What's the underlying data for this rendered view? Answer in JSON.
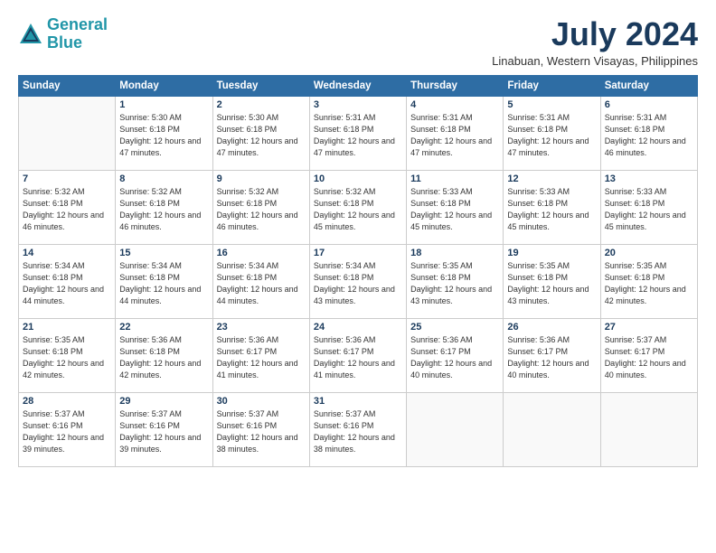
{
  "logo": {
    "line1": "General",
    "line2": "Blue"
  },
  "title": "July 2024",
  "location": "Linabuan, Western Visayas, Philippines",
  "weekdays": [
    "Sunday",
    "Monday",
    "Tuesday",
    "Wednesday",
    "Thursday",
    "Friday",
    "Saturday"
  ],
  "weeks": [
    [
      {
        "day": "",
        "sunrise": "",
        "sunset": "",
        "daylight": ""
      },
      {
        "day": "1",
        "sunrise": "Sunrise: 5:30 AM",
        "sunset": "Sunset: 6:18 PM",
        "daylight": "Daylight: 12 hours and 47 minutes."
      },
      {
        "day": "2",
        "sunrise": "Sunrise: 5:30 AM",
        "sunset": "Sunset: 6:18 PM",
        "daylight": "Daylight: 12 hours and 47 minutes."
      },
      {
        "day": "3",
        "sunrise": "Sunrise: 5:31 AM",
        "sunset": "Sunset: 6:18 PM",
        "daylight": "Daylight: 12 hours and 47 minutes."
      },
      {
        "day": "4",
        "sunrise": "Sunrise: 5:31 AM",
        "sunset": "Sunset: 6:18 PM",
        "daylight": "Daylight: 12 hours and 47 minutes."
      },
      {
        "day": "5",
        "sunrise": "Sunrise: 5:31 AM",
        "sunset": "Sunset: 6:18 PM",
        "daylight": "Daylight: 12 hours and 47 minutes."
      },
      {
        "day": "6",
        "sunrise": "Sunrise: 5:31 AM",
        "sunset": "Sunset: 6:18 PM",
        "daylight": "Daylight: 12 hours and 46 minutes."
      }
    ],
    [
      {
        "day": "7",
        "sunrise": "Sunrise: 5:32 AM",
        "sunset": "Sunset: 6:18 PM",
        "daylight": "Daylight: 12 hours and 46 minutes."
      },
      {
        "day": "8",
        "sunrise": "Sunrise: 5:32 AM",
        "sunset": "Sunset: 6:18 PM",
        "daylight": "Daylight: 12 hours and 46 minutes."
      },
      {
        "day": "9",
        "sunrise": "Sunrise: 5:32 AM",
        "sunset": "Sunset: 6:18 PM",
        "daylight": "Daylight: 12 hours and 46 minutes."
      },
      {
        "day": "10",
        "sunrise": "Sunrise: 5:32 AM",
        "sunset": "Sunset: 6:18 PM",
        "daylight": "Daylight: 12 hours and 45 minutes."
      },
      {
        "day": "11",
        "sunrise": "Sunrise: 5:33 AM",
        "sunset": "Sunset: 6:18 PM",
        "daylight": "Daylight: 12 hours and 45 minutes."
      },
      {
        "day": "12",
        "sunrise": "Sunrise: 5:33 AM",
        "sunset": "Sunset: 6:18 PM",
        "daylight": "Daylight: 12 hours and 45 minutes."
      },
      {
        "day": "13",
        "sunrise": "Sunrise: 5:33 AM",
        "sunset": "Sunset: 6:18 PM",
        "daylight": "Daylight: 12 hours and 45 minutes."
      }
    ],
    [
      {
        "day": "14",
        "sunrise": "Sunrise: 5:34 AM",
        "sunset": "Sunset: 6:18 PM",
        "daylight": "Daylight: 12 hours and 44 minutes."
      },
      {
        "day": "15",
        "sunrise": "Sunrise: 5:34 AM",
        "sunset": "Sunset: 6:18 PM",
        "daylight": "Daylight: 12 hours and 44 minutes."
      },
      {
        "day": "16",
        "sunrise": "Sunrise: 5:34 AM",
        "sunset": "Sunset: 6:18 PM",
        "daylight": "Daylight: 12 hours and 44 minutes."
      },
      {
        "day": "17",
        "sunrise": "Sunrise: 5:34 AM",
        "sunset": "Sunset: 6:18 PM",
        "daylight": "Daylight: 12 hours and 43 minutes."
      },
      {
        "day": "18",
        "sunrise": "Sunrise: 5:35 AM",
        "sunset": "Sunset: 6:18 PM",
        "daylight": "Daylight: 12 hours and 43 minutes."
      },
      {
        "day": "19",
        "sunrise": "Sunrise: 5:35 AM",
        "sunset": "Sunset: 6:18 PM",
        "daylight": "Daylight: 12 hours and 43 minutes."
      },
      {
        "day": "20",
        "sunrise": "Sunrise: 5:35 AM",
        "sunset": "Sunset: 6:18 PM",
        "daylight": "Daylight: 12 hours and 42 minutes."
      }
    ],
    [
      {
        "day": "21",
        "sunrise": "Sunrise: 5:35 AM",
        "sunset": "Sunset: 6:18 PM",
        "daylight": "Daylight: 12 hours and 42 minutes."
      },
      {
        "day": "22",
        "sunrise": "Sunrise: 5:36 AM",
        "sunset": "Sunset: 6:18 PM",
        "daylight": "Daylight: 12 hours and 42 minutes."
      },
      {
        "day": "23",
        "sunrise": "Sunrise: 5:36 AM",
        "sunset": "Sunset: 6:17 PM",
        "daylight": "Daylight: 12 hours and 41 minutes."
      },
      {
        "day": "24",
        "sunrise": "Sunrise: 5:36 AM",
        "sunset": "Sunset: 6:17 PM",
        "daylight": "Daylight: 12 hours and 41 minutes."
      },
      {
        "day": "25",
        "sunrise": "Sunrise: 5:36 AM",
        "sunset": "Sunset: 6:17 PM",
        "daylight": "Daylight: 12 hours and 40 minutes."
      },
      {
        "day": "26",
        "sunrise": "Sunrise: 5:36 AM",
        "sunset": "Sunset: 6:17 PM",
        "daylight": "Daylight: 12 hours and 40 minutes."
      },
      {
        "day": "27",
        "sunrise": "Sunrise: 5:37 AM",
        "sunset": "Sunset: 6:17 PM",
        "daylight": "Daylight: 12 hours and 40 minutes."
      }
    ],
    [
      {
        "day": "28",
        "sunrise": "Sunrise: 5:37 AM",
        "sunset": "Sunset: 6:16 PM",
        "daylight": "Daylight: 12 hours and 39 minutes."
      },
      {
        "day": "29",
        "sunrise": "Sunrise: 5:37 AM",
        "sunset": "Sunset: 6:16 PM",
        "daylight": "Daylight: 12 hours and 39 minutes."
      },
      {
        "day": "30",
        "sunrise": "Sunrise: 5:37 AM",
        "sunset": "Sunset: 6:16 PM",
        "daylight": "Daylight: 12 hours and 38 minutes."
      },
      {
        "day": "31",
        "sunrise": "Sunrise: 5:37 AM",
        "sunset": "Sunset: 6:16 PM",
        "daylight": "Daylight: 12 hours and 38 minutes."
      },
      {
        "day": "",
        "sunrise": "",
        "sunset": "",
        "daylight": ""
      },
      {
        "day": "",
        "sunrise": "",
        "sunset": "",
        "daylight": ""
      },
      {
        "day": "",
        "sunrise": "",
        "sunset": "",
        "daylight": ""
      }
    ]
  ]
}
